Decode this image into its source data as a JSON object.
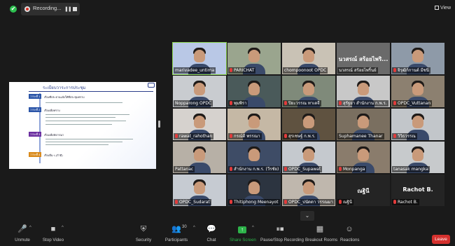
{
  "topbar": {
    "recording_label": "Recording...",
    "pause_glyph": "❚❚",
    "view_label": "View",
    "icons": [
      "shield-icon",
      "record-icon",
      "pause-icon",
      "stop-icon",
      "grid-icon"
    ]
  },
  "share": {
    "title": "ระเบียบวาระการประชุม",
    "steps": [
      {
        "label": "วาระที่ 1",
        "text": "เรื่องที่ประธานแจ้งให้ที่ประชุมทราบ"
      },
      {
        "label": "วาระที่ 2",
        "text": "เรื่องเพื่อทราบ"
      },
      {
        "label": "วาระที่ 3",
        "text": "เรื่องเพื่อพิจารณา"
      },
      {
        "label": "วาระที่ 4",
        "text": "เรื่องอื่น ๆ (ถ้ามี)"
      }
    ]
  },
  "participants": [
    {
      "name": "marivadee_untima",
      "active": true,
      "muted": false
    },
    {
      "name": "PARICHAT",
      "muted": true
    },
    {
      "name": "chompoonoot OPDC",
      "muted": false
    },
    {
      "name": "นวสรณ์ สร้อยไพริ้นย์",
      "muted": false,
      "display": "นวสรณ์ สร้อยไพริ..."
    },
    {
      "name": "จิรุฒิก์กานต์ มีชนิ",
      "muted": true
    },
    {
      "name": "Nopparong OPDC",
      "muted": false
    },
    {
      "name": "พุมพิรา",
      "muted": true
    },
    {
      "name": "ปิยะวรรณ ทาเตจี",
      "muted": true
    },
    {
      "name": "สุรัฐยา สำนักงาน ก.พ.ร.",
      "muted": true
    },
    {
      "name": "OPDC_Vuttanan",
      "muted": true
    },
    {
      "name": "rawat_rahothan",
      "muted": true
    },
    {
      "name": "กรณ์ตี พรรณา",
      "muted": true
    },
    {
      "name": "สุรเชษฐ์ ก.พ.ร.",
      "muted": true
    },
    {
      "name": "Suphamanee Thanar",
      "muted": false
    },
    {
      "name": "วิวิธวรรณ",
      "muted": true
    },
    {
      "name": "Pattanac",
      "muted": false
    },
    {
      "name": "สำนักงาน ก.พ.ร. (วีรชัย)",
      "muted": true
    },
    {
      "name": "OPDC_Supawat",
      "muted": true
    },
    {
      "name": "Monpanga",
      "muted": true
    },
    {
      "name": "tanasak mangka",
      "muted": false
    },
    {
      "name": "OPDC_Sudarat",
      "muted": true
    },
    {
      "name": "Thitiphong Meenayot",
      "muted": true
    },
    {
      "name": "OPDC_ปนัดดา วรรณมา",
      "muted": true
    },
    {
      "name": "ณฐินี",
      "muted": true,
      "display": "ณฐินี"
    },
    {
      "name": "Rachot B.",
      "muted": true,
      "display": "Rachot B."
    }
  ],
  "scroll_down_glyph": "⌄",
  "toolbar": {
    "unmute": "Unmute",
    "stop_video": "Stop Video",
    "security": "Security",
    "participants": "Participants",
    "participants_count": "30",
    "chat": "Chat",
    "share_screen": "Share Screen",
    "pause_recording": "Pause/Stop Recording",
    "breakout": "Breakout Rooms",
    "reactions": "Reactions",
    "leave": "Leave",
    "caret": "^"
  },
  "colors": {
    "background": "#1a1a1a",
    "active_speaker": "#8ad24a",
    "share_green": "#2db34a",
    "leave_red": "#d5312e",
    "mic_muted": "#e23b3b"
  }
}
